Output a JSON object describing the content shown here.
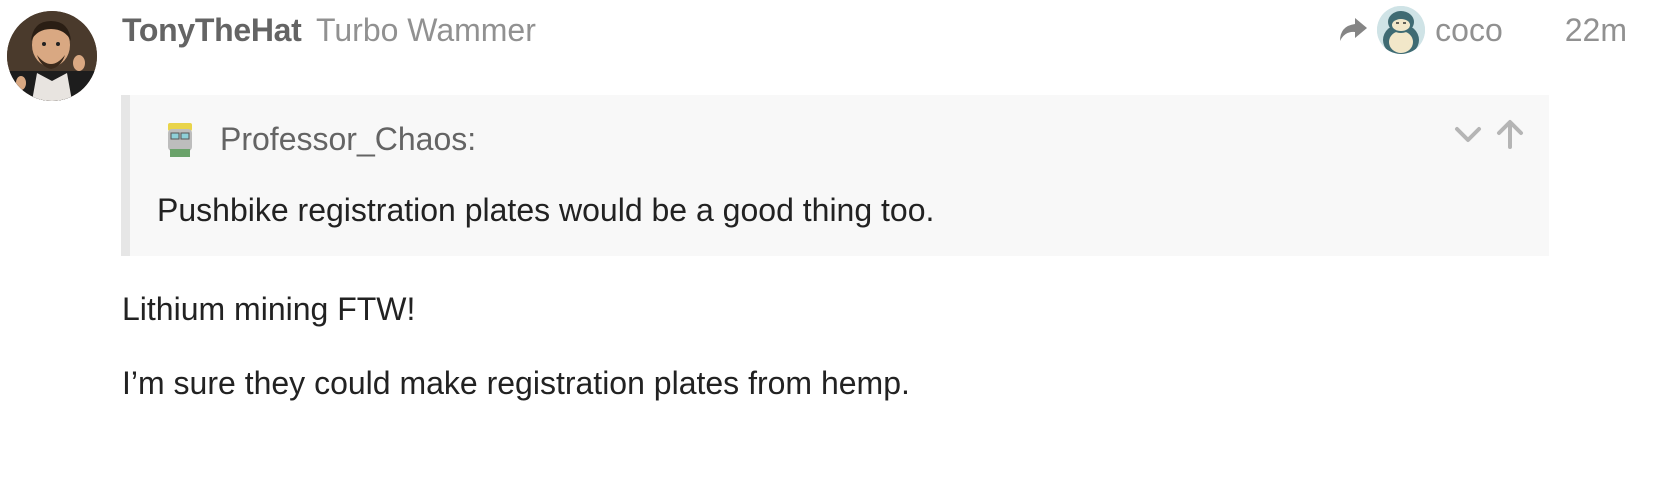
{
  "post": {
    "username": "TonyTheHat",
    "user_title": "Turbo Wammer",
    "reply_to_user": "coco",
    "date": "22m",
    "quote": {
      "author": "Professor_Chaos:",
      "text": "Pushbike registration plates would be a good thing too."
    },
    "paragraphs": [
      "Lithium mining FTW!",
      "I’m sure they could make registration plates from hemp."
    ]
  },
  "icons": {
    "reply": "share-arrow-icon",
    "expand": "chevron-down-icon",
    "go_to_quoted": "arrow-up-icon"
  }
}
